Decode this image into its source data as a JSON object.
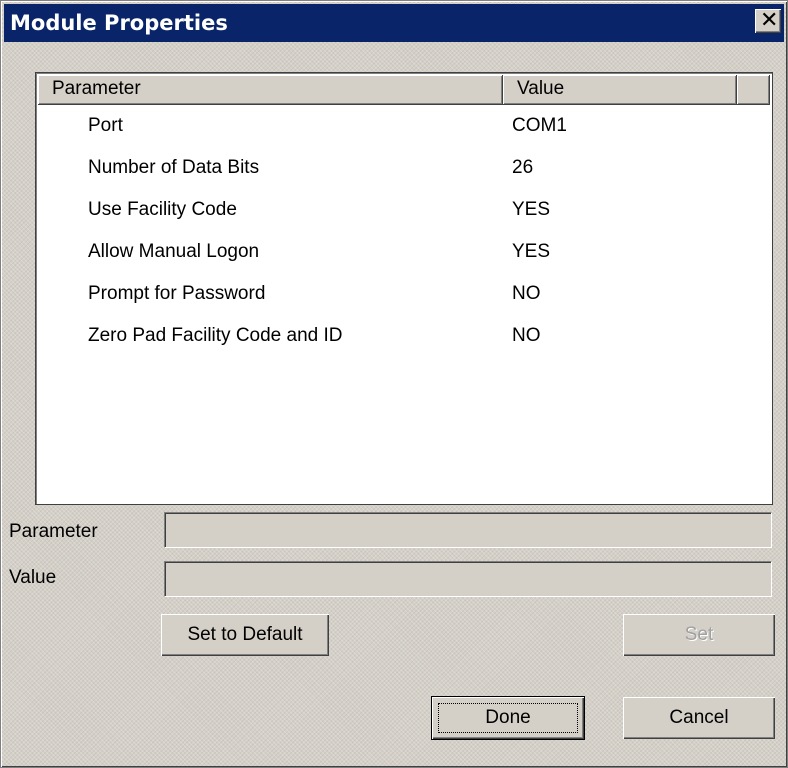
{
  "window": {
    "title": "Module Properties",
    "close_glyph": "✕"
  },
  "table": {
    "columns": [
      "Parameter",
      "Value"
    ],
    "rows": [
      {
        "parameter": "Port",
        "value": "COM1"
      },
      {
        "parameter": "Number of Data Bits",
        "value": "26"
      },
      {
        "parameter": "Use Facility Code",
        "value": "YES"
      },
      {
        "parameter": "Allow Manual Logon",
        "value": "YES"
      },
      {
        "parameter": "Prompt for Password",
        "value": "NO"
      },
      {
        "parameter": "Zero Pad Facility Code and ID",
        "value": "NO"
      }
    ]
  },
  "editor": {
    "parameter_label": "Parameter",
    "parameter_value": "",
    "value_label": "Value",
    "value_value": ""
  },
  "buttons": {
    "set_to_default": "Set to Default",
    "set": "Set",
    "done": "Done",
    "cancel": "Cancel"
  },
  "colors": {
    "titlebar": "#0a246a",
    "dialog_face": "#d4d0c8"
  }
}
